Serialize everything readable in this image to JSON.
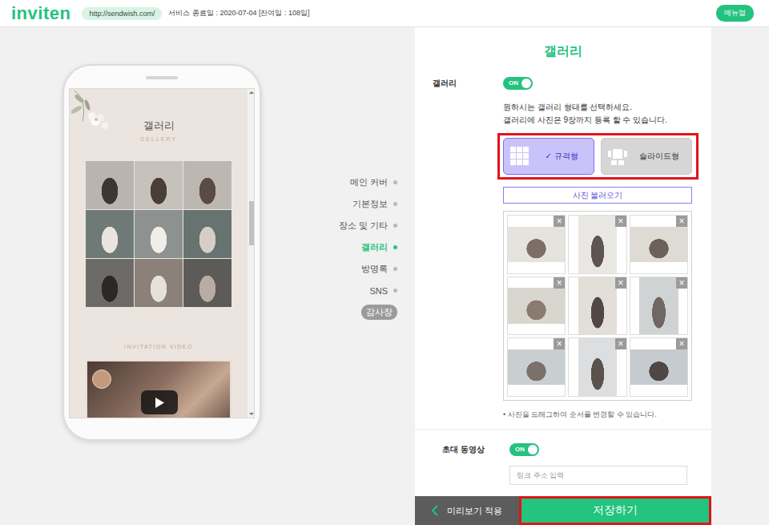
{
  "header": {
    "logo": "inviten",
    "url": "http://sendwish.com/",
    "service_end": "서비스 종료일 : 2020-07-04 [잔여일 : 108일]",
    "manual_button": "메뉴얼"
  },
  "preview": {
    "title": "갤러리",
    "subtitle": "GELLERY",
    "video_label": "INVITATION VIDEO"
  },
  "nav": [
    {
      "label": "메인 커버",
      "selected": false,
      "kind": "link"
    },
    {
      "label": "기본정보",
      "selected": false,
      "kind": "link"
    },
    {
      "label": "장소 및 기타",
      "selected": false,
      "kind": "link"
    },
    {
      "label": "갤러리",
      "selected": true,
      "kind": "link"
    },
    {
      "label": "방명록",
      "selected": false,
      "kind": "link"
    },
    {
      "label": "SNS",
      "selected": false,
      "kind": "link"
    },
    {
      "label": "감사장",
      "selected": false,
      "kind": "badge"
    }
  ],
  "editor": {
    "title": "갤러리",
    "gallery_toggle": {
      "label": "갤러리",
      "state": "ON",
      "on": true
    },
    "description": [
      "원하시는 갤러리 형태를 선택하세요.",
      "갤러리에 사진은 9장까지 등록 할 수 있습니다."
    ],
    "layout_check": "✓",
    "layouts": [
      {
        "label": "규격형",
        "selected": true,
        "kind": "grid"
      },
      {
        "label": "슬라이드형",
        "selected": false,
        "kind": "slide"
      }
    ],
    "load_button": "사진 불러오기",
    "photos": [
      {
        "remove": "×"
      },
      {
        "remove": "×"
      },
      {
        "remove": "×"
      },
      {
        "remove": "×"
      },
      {
        "remove": "×"
      },
      {
        "remove": "×"
      },
      {
        "remove": "×"
      },
      {
        "remove": "×"
      },
      {
        "remove": "×"
      }
    ],
    "hint": "•  사진을 드래그하여 순서를 변경할 수 있습니다.",
    "video_toggle": {
      "label": "초대 동영상",
      "state": "ON",
      "on": true
    },
    "video_input": {
      "placeholder": "링크 주소 입력"
    }
  },
  "footer": {
    "preview_button": "미리보기 적용",
    "save_button": "저장하기"
  }
}
